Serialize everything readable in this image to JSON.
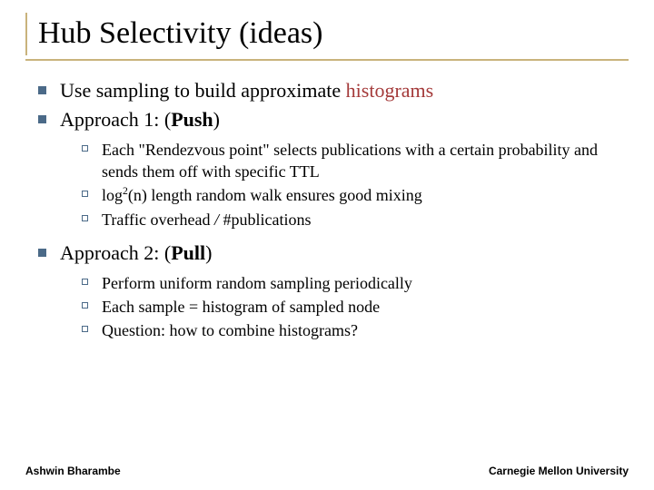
{
  "title": "Hub Selectivity (ideas)",
  "bullet1_pre": "Use sampling to build approximate ",
  "bullet1_hist": "histograms",
  "bullet2_pre": "Approach 1: (",
  "bullet2_push": "Push",
  "bullet2_post": ")",
  "sub2a": "Each \"Rendezvous point\" selects publications with a certain probability and sends them off with specific TTL",
  "sub2b_pre": "log",
  "sub2b_sup": "2",
  "sub2b_post": "(n) length random walk ensures good mixing",
  "sub2c_pre": "Traffic overhead ",
  "sub2c_sym": "/",
  "sub2c_post": " #publications",
  "bullet3_pre": "Approach 2: (",
  "bullet3_pull": "Pull",
  "bullet3_post": ")",
  "sub3a": "Perform uniform random sampling periodically",
  "sub3b": "Each sample = histogram of sampled node",
  "sub3c": "Question: how to combine histograms?",
  "footer_left": "Ashwin Bharambe",
  "footer_right": "Carnegie Mellon University"
}
